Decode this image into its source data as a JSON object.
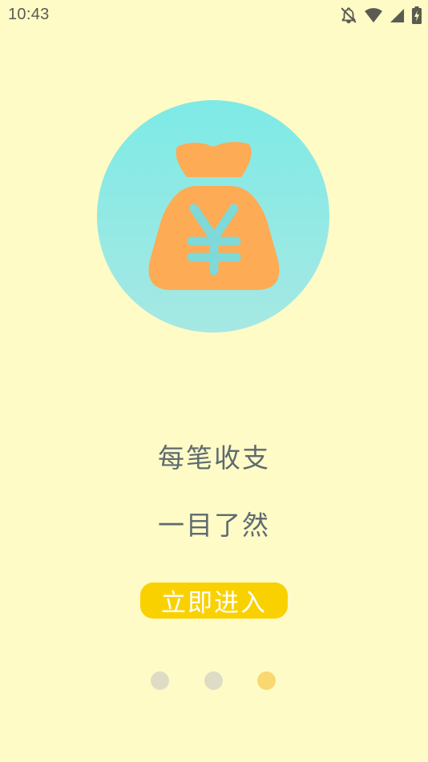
{
  "status_bar": {
    "time": "10:43",
    "icons": [
      "notifications-off-icon",
      "wifi-icon",
      "cellular-signal-icon",
      "battery-charging-icon"
    ]
  },
  "illustration": {
    "icon": "money-bag-yen-icon",
    "symbol": "¥"
  },
  "headline": {
    "line1": "每笔收支",
    "line2": "一目了然"
  },
  "enter_button": {
    "label": "立即进入"
  },
  "pager": {
    "page_count": 3,
    "current_page": 3
  },
  "colors": {
    "background": "#fefbc6",
    "circle_top": "#7eeae6",
    "circle_bottom": "#a6e8e3",
    "bag": "#fdab55",
    "yen": "#7ed9d8",
    "headline_text": "#5e6a70",
    "button": "#fad100",
    "button_text": "#ffffff",
    "dot_inactive": "#dedcc4",
    "dot_active": "#fad871",
    "status_text": "#5b5b52"
  }
}
